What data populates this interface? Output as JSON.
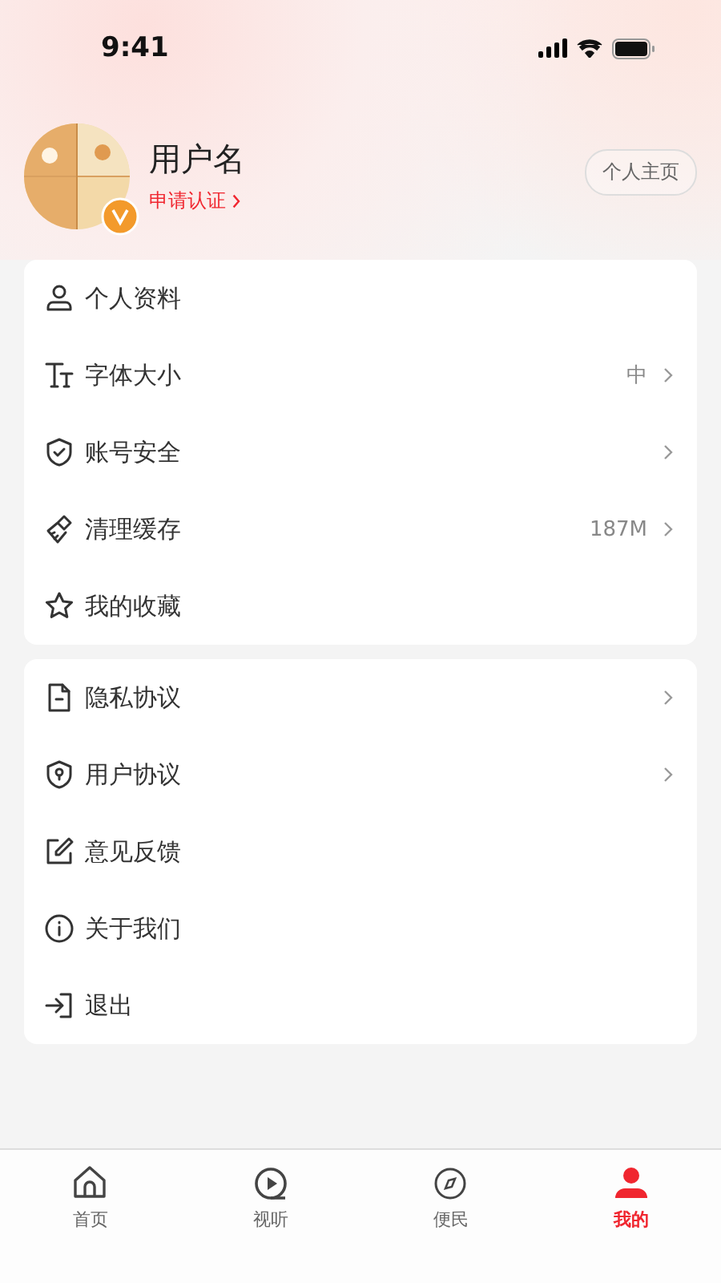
{
  "status_bar": {
    "time": "9:41"
  },
  "profile": {
    "name": "用户名",
    "verify_link": "申请认证",
    "verified": true,
    "homepage_button": "个人主页"
  },
  "menu_groups": [
    {
      "items": [
        {
          "label": "个人资料",
          "chevron": false
        },
        {
          "label": "字体大小",
          "value": "中",
          "chevron": true
        },
        {
          "label": "账号安全",
          "chevron": true
        },
        {
          "label": "清理缓存",
          "value": "187M",
          "chevron": true
        },
        {
          "label": "我的收藏",
          "chevron": false
        }
      ]
    },
    {
      "items": [
        {
          "label": "隐私协议",
          "chevron": true
        },
        {
          "label": "用户协议",
          "chevron": true
        },
        {
          "label": "意见反馈",
          "chevron": false
        },
        {
          "label": "关于我们",
          "chevron": false
        },
        {
          "label": "退出",
          "chevron": false
        }
      ]
    }
  ],
  "tab_bar": [
    {
      "label": "首页",
      "selected": false
    },
    {
      "label": "视听",
      "selected": false
    },
    {
      "label": "便民",
      "selected": false
    },
    {
      "label": "我的",
      "selected": true
    }
  ]
}
